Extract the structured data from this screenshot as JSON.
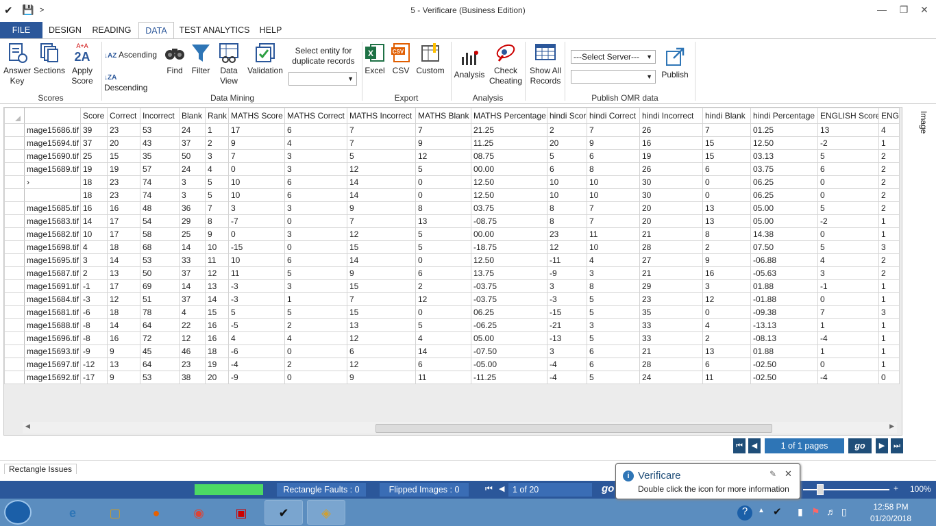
{
  "window": {
    "title": "5 - Verificare (Business Edition)"
  },
  "tabs": [
    "FILE",
    "DESIGN",
    "READING",
    "DATA",
    "TEST ANALYTICS",
    "HELP"
  ],
  "ribbon": {
    "answer_key": "Answer Key",
    "sections": "Sections",
    "apply_score": "Apply Score",
    "scores_group": "Scores",
    "ascending": "Ascending",
    "descending": "Descending",
    "find": "Find",
    "filter": "Filter",
    "data_view": "Data View",
    "validation": "Validation",
    "select_entity": "Select entity for duplicate records",
    "data_mining_group": "Data Mining",
    "excel": "Excel",
    "csv": "CSV",
    "custom": "Custom",
    "export_group": "Export",
    "analysis": "Analysis",
    "check_cheating": "Check Cheating",
    "analysis_group": "Analysis",
    "show_all": "Show All Records",
    "select_server": "---Select Server---",
    "publish": "Publish",
    "publish_group": "Publish OMR data"
  },
  "grid": {
    "columns": [
      "",
      "Score",
      "Correct",
      "Incorrect",
      "Blank",
      "Rank",
      "MATHS Score",
      "MATHS Correct",
      "MATHS Incorrect",
      "MATHS Blank",
      "MATHS Percentage",
      "hindi Score",
      "hindi Correct",
      "hindi Incorrect",
      "hindi Blank",
      "hindi Percentage",
      "ENGLISH Score",
      "ENG"
    ],
    "rows": [
      [
        "mage15686.tif",
        "39",
        "23",
        "53",
        "24",
        "1",
        "17",
        "6",
        "7",
        "7",
        "21.25",
        "2",
        "7",
        "26",
        "7",
        "01.25",
        "13",
        "4"
      ],
      [
        "mage15694.tif",
        "37",
        "20",
        "43",
        "37",
        "2",
        "9",
        "4",
        "7",
        "9",
        "11.25",
        "20",
        "9",
        "16",
        "15",
        "12.50",
        "-2",
        "1"
      ],
      [
        "mage15690.tif",
        "25",
        "15",
        "35",
        "50",
        "3",
        "7",
        "3",
        "5",
        "12",
        "08.75",
        "5",
        "6",
        "19",
        "15",
        "03.13",
        "5",
        "2"
      ],
      [
        "mage15689.tif",
        "19",
        "19",
        "57",
        "24",
        "4",
        "0",
        "3",
        "12",
        "5",
        "00.00",
        "6",
        "8",
        "26",
        "6",
        "03.75",
        "6",
        "2"
      ],
      [
        "›",
        "18",
        "23",
        "74",
        "3",
        "5",
        "10",
        "6",
        "14",
        "0",
        "12.50",
        "10",
        "10",
        "30",
        "0",
        "06.25",
        "0",
        "2"
      ],
      [
        "",
        "18",
        "23",
        "74",
        "3",
        "5",
        "10",
        "6",
        "14",
        "0",
        "12.50",
        "10",
        "10",
        "30",
        "0",
        "06.25",
        "0",
        "2"
      ],
      [
        "mage15685.tif",
        "16",
        "16",
        "48",
        "36",
        "7",
        "3",
        "3",
        "9",
        "8",
        "03.75",
        "8",
        "7",
        "20",
        "13",
        "05.00",
        "5",
        "2"
      ],
      [
        "mage15683.tif",
        "14",
        "17",
        "54",
        "29",
        "8",
        "-7",
        "0",
        "7",
        "13",
        "-08.75",
        "8",
        "7",
        "20",
        "13",
        "05.00",
        "-2",
        "1"
      ],
      [
        "mage15682.tif",
        "10",
        "17",
        "58",
        "25",
        "9",
        "0",
        "3",
        "12",
        "5",
        "00.00",
        "23",
        "11",
        "21",
        "8",
        "14.38",
        "0",
        "1"
      ],
      [
        "mage15698.tif",
        "4",
        "18",
        "68",
        "14",
        "10",
        "-15",
        "0",
        "15",
        "5",
        "-18.75",
        "12",
        "10",
        "28",
        "2",
        "07.50",
        "5",
        "3"
      ],
      [
        "mage15695.tif",
        "3",
        "14",
        "53",
        "33",
        "11",
        "10",
        "6",
        "14",
        "0",
        "12.50",
        "-11",
        "4",
        "27",
        "9",
        "-06.88",
        "4",
        "2"
      ],
      [
        "mage15687.tif",
        "2",
        "13",
        "50",
        "37",
        "12",
        "11",
        "5",
        "9",
        "6",
        "13.75",
        "-9",
        "3",
        "21",
        "16",
        "-05.63",
        "3",
        "2"
      ],
      [
        "mage15691.tif",
        "-1",
        "17",
        "69",
        "14",
        "13",
        "-3",
        "3",
        "15",
        "2",
        "-03.75",
        "3",
        "8",
        "29",
        "3",
        "01.88",
        "-1",
        "1"
      ],
      [
        "mage15684.tif",
        "-3",
        "12",
        "51",
        "37",
        "14",
        "-3",
        "1",
        "7",
        "12",
        "-03.75",
        "-3",
        "5",
        "23",
        "12",
        "-01.88",
        "0",
        "1"
      ],
      [
        "mage15681.tif",
        "-6",
        "18",
        "78",
        "4",
        "15",
        "5",
        "5",
        "15",
        "0",
        "06.25",
        "-15",
        "5",
        "35",
        "0",
        "-09.38",
        "7",
        "3"
      ],
      [
        "mage15688.tif",
        "-8",
        "14",
        "64",
        "22",
        "16",
        "-5",
        "2",
        "13",
        "5",
        "-06.25",
        "-21",
        "3",
        "33",
        "4",
        "-13.13",
        "1",
        "1"
      ],
      [
        "mage15696.tif",
        "-8",
        "16",
        "72",
        "12",
        "16",
        "4",
        "4",
        "12",
        "4",
        "05.00",
        "-13",
        "5",
        "33",
        "2",
        "-08.13",
        "-4",
        "1"
      ],
      [
        "mage15693.tif",
        "-9",
        "9",
        "45",
        "46",
        "18",
        "-6",
        "0",
        "6",
        "14",
        "-07.50",
        "3",
        "6",
        "21",
        "13",
        "01.88",
        "1",
        "1"
      ],
      [
        "mage15697.tif",
        "-12",
        "13",
        "64",
        "23",
        "19",
        "-4",
        "2",
        "12",
        "6",
        "-05.00",
        "-4",
        "6",
        "28",
        "6",
        "-02.50",
        "0",
        "1"
      ],
      [
        "mage15692.tif",
        "-17",
        "9",
        "53",
        "38",
        "20",
        "-9",
        "0",
        "9",
        "11",
        "-11.25",
        "-4",
        "5",
        "24",
        "11",
        "-02.50",
        "-4",
        "0"
      ]
    ]
  },
  "side_tab": "Image",
  "pager": {
    "info": "1 of 1 pages",
    "go": "go"
  },
  "issues_tab": "Rectangle Issues",
  "status": {
    "rect_faults": "Rectangle Faults : 0",
    "flipped": "Flipped Images : 0",
    "page": "1 of 20",
    "go": "go",
    "zoom": "100%"
  },
  "balloon": {
    "title": "Verificare",
    "text": "Double click the icon for more information"
  },
  "clock": {
    "time": "12:58 PM",
    "date": "01/20/2018"
  }
}
